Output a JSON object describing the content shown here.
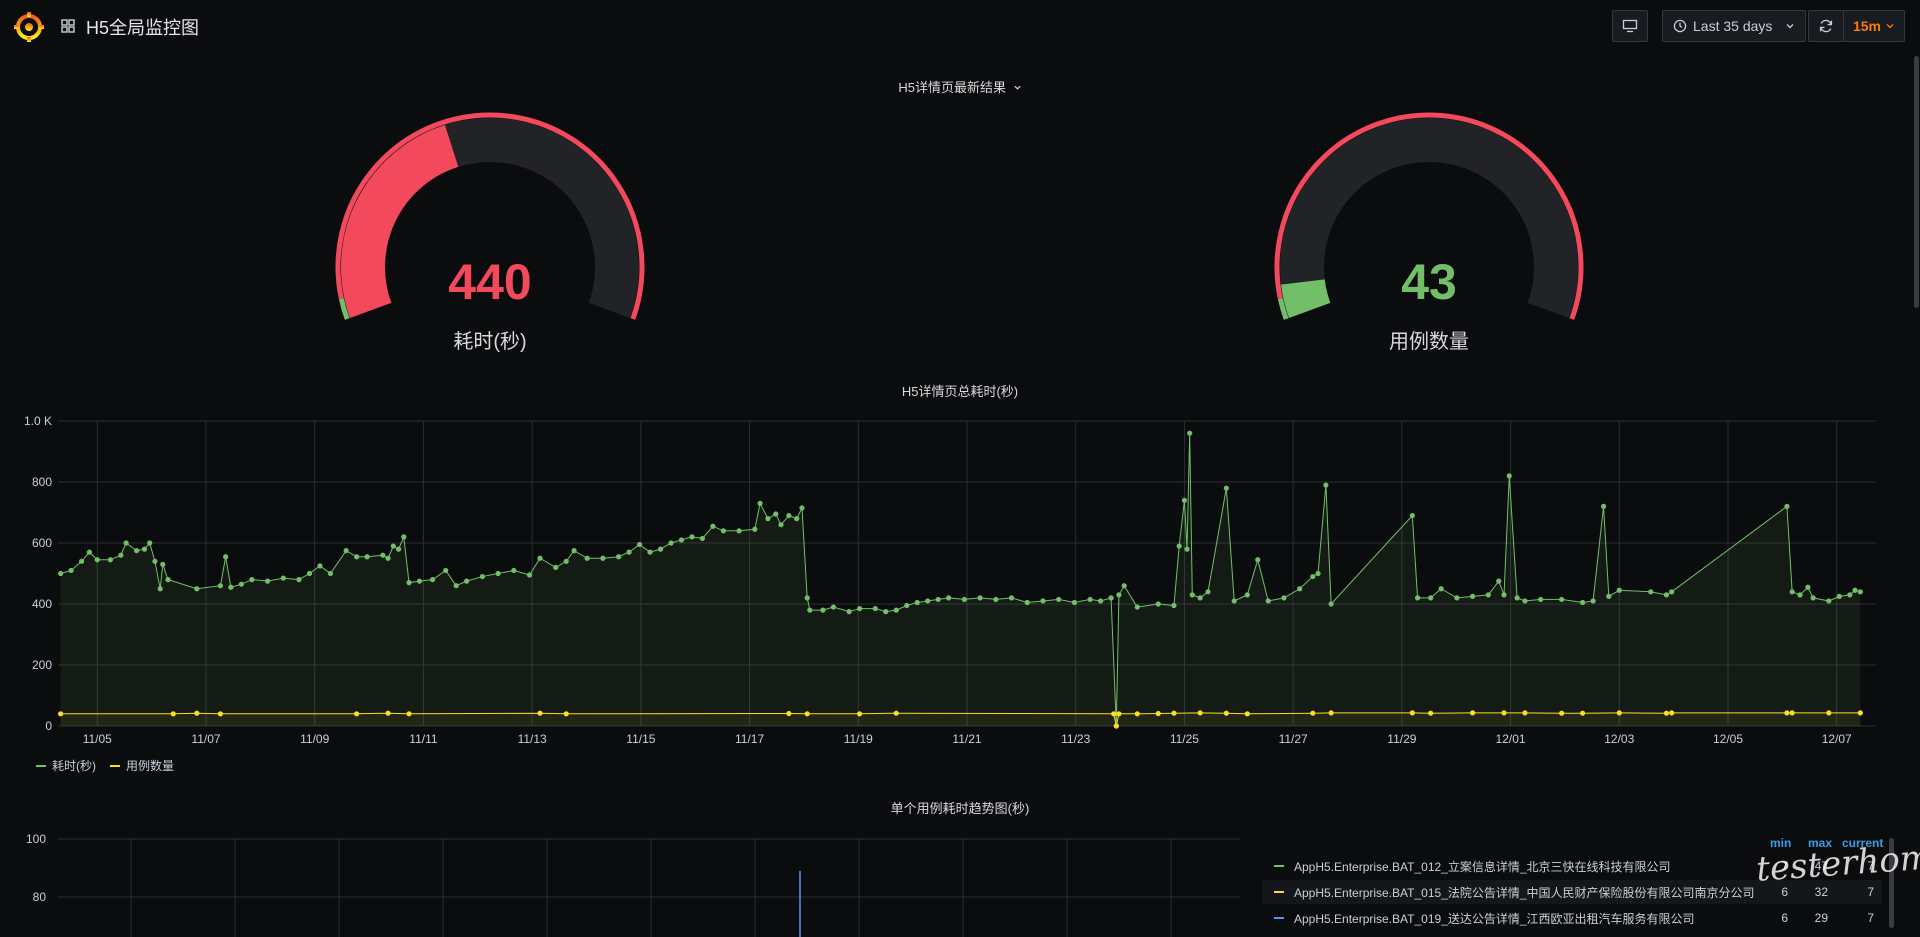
{
  "header": {
    "title": "H5全局监控图",
    "time_range": "Last 35 days",
    "refresh_interval": "15m",
    "icons": {
      "logo": "grafana-logo-icon",
      "dashboards": "dashboard-grid-icon",
      "tv": "tv-mode-icon",
      "clock": "clock-icon",
      "chevron": "chevron-down-icon",
      "refresh": "refresh-icon"
    }
  },
  "row": {
    "title": "H5详情页最新结果"
  },
  "gauges": [
    {
      "value": "440",
      "label": "耗时(秒)",
      "value_color": "#f2495c",
      "fill_fraction": 0.42
    },
    {
      "value": "43",
      "label": "用例数量",
      "value_color": "#73bf69",
      "fill_fraction": 0.06
    }
  ],
  "colors": {
    "green": "#73bf69",
    "red": "#f2495c",
    "yellow": "#fade2a",
    "blue": "#5794f2",
    "legend_head": "#33a2e5"
  },
  "chart_data": [
    {
      "type": "line",
      "title": "H5详情页总耗时(秒)",
      "x_ticks": [
        "11/05",
        "11/07",
        "11/09",
        "11/11",
        "11/13",
        "11/15",
        "11/17",
        "11/19",
        "11/21",
        "11/23",
        "11/25",
        "11/27",
        "11/29",
        "12/01",
        "12/03",
        "12/05",
        "12/07"
      ],
      "y_ticks": [
        "0",
        "200",
        "400",
        "600",
        "800",
        "1.0 K"
      ],
      "ylim": [
        0,
        1000
      ],
      "xlim_days": [
        0,
        35
      ],
      "grid": true,
      "legend_placement": "bottom-left",
      "series": [
        {
          "name": "耗时(秒)",
          "color": "#73bf69",
          "points": [
            [
              0.1,
              500
            ],
            [
              0.5,
              510
            ],
            [
              0.9,
              540
            ],
            [
              1.2,
              570
            ],
            [
              1.5,
              545
            ],
            [
              2.0,
              545
            ],
            [
              2.4,
              560
            ],
            [
              2.6,
              600
            ],
            [
              3.0,
              575
            ],
            [
              3.3,
              580
            ],
            [
              3.5,
              600
            ],
            [
              3.7,
              540
            ],
            [
              3.9,
              450
            ],
            [
              4.0,
              530
            ],
            [
              4.2,
              480
            ],
            [
              5.3,
              450
            ],
            [
              6.2,
              460
            ],
            [
              6.4,
              555
            ],
            [
              6.6,
              455
            ],
            [
              7.0,
              465
            ],
            [
              7.4,
              480
            ],
            [
              8.0,
              475
            ],
            [
              8.6,
              485
            ],
            [
              9.2,
              480
            ],
            [
              9.6,
              500
            ],
            [
              10.0,
              525
            ],
            [
              10.4,
              500
            ],
            [
              11.0,
              575
            ],
            [
              11.4,
              555
            ],
            [
              11.8,
              555
            ],
            [
              12.4,
              560
            ],
            [
              12.6,
              550
            ],
            [
              12.8,
              590
            ],
            [
              13.0,
              580
            ],
            [
              13.2,
              620
            ],
            [
              13.4,
              470
            ],
            [
              13.8,
              475
            ],
            [
              14.3,
              480
            ],
            [
              14.8,
              510
            ],
            [
              15.2,
              460
            ],
            [
              15.6,
              475
            ],
            [
              16.2,
              490
            ],
            [
              16.8,
              500
            ],
            [
              17.4,
              510
            ],
            [
              18.0,
              495
            ],
            [
              18.4,
              550
            ],
            [
              19.0,
              520
            ],
            [
              19.4,
              540
            ],
            [
              19.7,
              575
            ],
            [
              20.2,
              550
            ],
            [
              20.8,
              550
            ],
            [
              21.4,
              555
            ],
            [
              21.8,
              570
            ],
            [
              22.2,
              595
            ],
            [
              22.6,
              570
            ],
            [
              23.0,
              580
            ],
            [
              23.4,
              600
            ],
            [
              23.8,
              610
            ],
            [
              24.2,
              620
            ],
            [
              24.6,
              615
            ],
            [
              25.0,
              655
            ],
            [
              25.4,
              640
            ],
            [
              26.0,
              640
            ],
            [
              26.6,
              645
            ],
            [
              26.8,
              730
            ],
            [
              27.1,
              680
            ],
            [
              27.4,
              695
            ],
            [
              27.6,
              660
            ],
            [
              27.9,
              690
            ],
            [
              28.2,
              680
            ],
            [
              28.4,
              715
            ],
            [
              28.6,
              420
            ],
            [
              28.7,
              380
            ],
            [
              29.2,
              380
            ],
            [
              29.6,
              390
            ],
            [
              30.2,
              375
            ],
            [
              30.6,
              385
            ],
            [
              31.2,
              385
            ],
            [
              31.6,
              375
            ],
            [
              32.0,
              380
            ],
            [
              32.4,
              395
            ],
            [
              32.8,
              405
            ],
            [
              33.2,
              410
            ],
            [
              33.6,
              415
            ],
            [
              34.0,
              420
            ],
            [
              34.6,
              415
            ],
            [
              35.2,
              420
            ],
            [
              35.8,
              415
            ],
            [
              36.4,
              420
            ],
            [
              37.0,
              405
            ],
            [
              37.6,
              410
            ],
            [
              38.2,
              415
            ],
            [
              38.8,
              405
            ],
            [
              39.4,
              415
            ],
            [
              39.8,
              410
            ],
            [
              40.2,
              420
            ],
            [
              40.4,
              0
            ],
            [
              40.5,
              430
            ],
            [
              40.7,
              460
            ],
            [
              41.2,
              390
            ],
            [
              42.0,
              400
            ],
            [
              42.6,
              395
            ],
            [
              42.8,
              590
            ],
            [
              43.0,
              740
            ],
            [
              43.1,
              580
            ],
            [
              43.2,
              960
            ],
            [
              43.3,
              430
            ],
            [
              43.6,
              420
            ],
            [
              43.9,
              440
            ],
            [
              44.6,
              780
            ],
            [
              44.9,
              410
            ],
            [
              45.4,
              430
            ],
            [
              45.8,
              545
            ],
            [
              46.2,
              410
            ],
            [
              46.8,
              420
            ],
            [
              47.4,
              450
            ],
            [
              47.9,
              490
            ],
            [
              48.1,
              500
            ],
            [
              48.4,
              790
            ],
            [
              48.6,
              400
            ],
            [
              51.7,
              690
            ],
            [
              51.9,
              420
            ],
            [
              52.4,
              420
            ],
            [
              52.8,
              450
            ],
            [
              53.4,
              420
            ],
            [
              54.0,
              425
            ],
            [
              54.6,
              430
            ],
            [
              55.0,
              475
            ],
            [
              55.2,
              430
            ],
            [
              55.4,
              820
            ],
            [
              55.7,
              420
            ],
            [
              56.0,
              410
            ],
            [
              56.6,
              415
            ],
            [
              57.4,
              415
            ],
            [
              58.2,
              405
            ],
            [
              58.6,
              410
            ],
            [
              59.0,
              720
            ],
            [
              59.2,
              425
            ],
            [
              59.6,
              445
            ],
            [
              60.8,
              440
            ],
            [
              61.4,
              430
            ],
            [
              61.6,
              440
            ],
            [
              66.0,
              720
            ],
            [
              66.2,
              440
            ],
            [
              66.5,
              430
            ],
            [
              66.8,
              455
            ],
            [
              67.0,
              420
            ],
            [
              67.6,
              410
            ],
            [
              68.0,
              425
            ],
            [
              68.4,
              430
            ],
            [
              68.6,
              445
            ],
            [
              68.8,
              440
            ]
          ]
        },
        {
          "name": "用例数量",
          "color": "#fade2a",
          "points": [
            [
              0.1,
              40
            ],
            [
              4.4,
              40
            ],
            [
              5.3,
              42
            ],
            [
              6.2,
              40
            ],
            [
              11.4,
              40
            ],
            [
              12.6,
              42
            ],
            [
              13.4,
              40
            ],
            [
              18.4,
              42
            ],
            [
              19.4,
              40
            ],
            [
              27.9,
              41
            ],
            [
              28.6,
              40
            ],
            [
              30.6,
              40
            ],
            [
              32.0,
              42
            ],
            [
              40.3,
              40
            ],
            [
              40.4,
              0
            ],
            [
              40.5,
              40
            ],
            [
              41.2,
              40
            ],
            [
              42.0,
              41
            ],
            [
              42.6,
              42
            ],
            [
              43.6,
              43
            ],
            [
              44.6,
              42
            ],
            [
              45.4,
              40
            ],
            [
              47.9,
              42
            ],
            [
              48.6,
              43
            ],
            [
              51.7,
              43
            ],
            [
              52.4,
              42
            ],
            [
              54.0,
              43
            ],
            [
              55.2,
              43
            ],
            [
              56.0,
              43
            ],
            [
              57.4,
              42
            ],
            [
              58.2,
              42
            ],
            [
              59.6,
              43
            ],
            [
              61.4,
              42
            ],
            [
              61.6,
              43
            ],
            [
              66.0,
              43
            ],
            [
              66.2,
              43
            ],
            [
              67.6,
              43
            ],
            [
              68.8,
              43
            ]
          ]
        }
      ]
    },
    {
      "type": "line",
      "title": "单个用例耗时趋势图(秒)",
      "y_ticks": [
        "80",
        "100"
      ],
      "ylim": [
        60,
        100
      ],
      "grid": true,
      "legend_placement": "right",
      "legend_columns": [
        "min",
        "max",
        "current"
      ],
      "series": [
        {
          "name": "AppH5.Enterprise.BAT_012_立案信息详情_北京三快在线科技有限公司",
          "color": "#73bf69",
          "min": "7",
          "max": "47",
          "current": "7"
        },
        {
          "name": "AppH5.Enterprise.BAT_015_法院公告详情_中国人民财产保险股份有限公司南京分公司",
          "color": "#fade2a",
          "min": "6",
          "max": "32",
          "current": "7"
        },
        {
          "name": "AppH5.Enterprise.BAT_019_送达公告详情_江西欧亚出租汽车服务有限公司",
          "color": "#5794f2",
          "min": "6",
          "max": "29",
          "current": "7"
        }
      ],
      "visible_spike": {
        "series_color": "#5794f2",
        "value": 89
      }
    }
  ],
  "watermark": "testerhome.com"
}
